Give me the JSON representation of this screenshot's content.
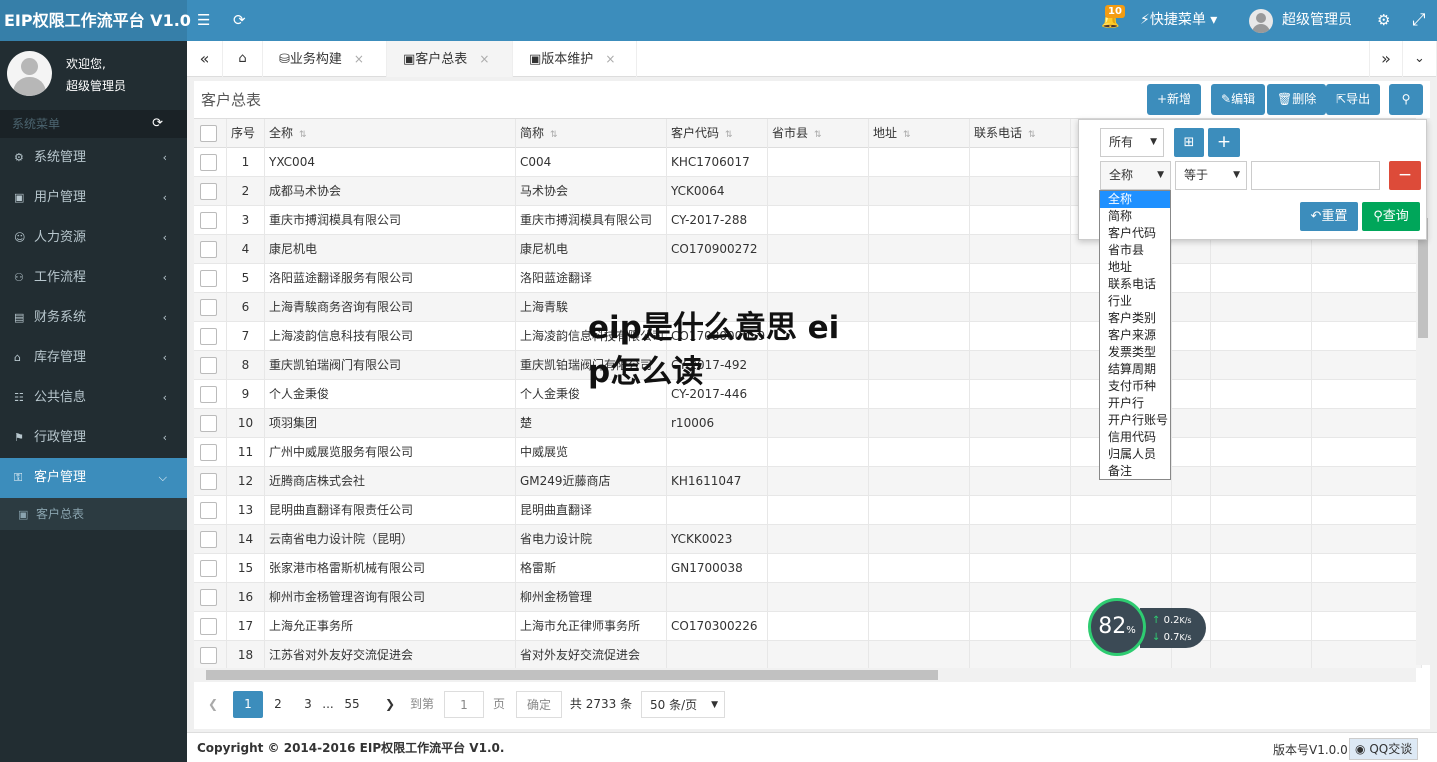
{
  "app": {
    "title": "EIP权限工作流平台 V1.0",
    "notif_count": "10",
    "quick_menu": "快捷菜单",
    "user_name": "超级管理员"
  },
  "sidebar": {
    "welcome": "欢迎您,",
    "user": "超级管理员",
    "menu_header": "系统菜单",
    "items": [
      {
        "label": "系统管理",
        "icon": "gear-icon"
      },
      {
        "label": "用户管理",
        "icon": "id-card-icon"
      },
      {
        "label": "人力资源",
        "icon": "user-icon"
      },
      {
        "label": "工作流程",
        "icon": "users-icon"
      },
      {
        "label": "财务系统",
        "icon": "money-icon"
      },
      {
        "label": "库存管理",
        "icon": "bank-icon"
      },
      {
        "label": "公共信息",
        "icon": "comments-icon"
      },
      {
        "label": "行政管理",
        "icon": "bookmark-icon"
      },
      {
        "label": "客户管理",
        "icon": "lock-icon"
      }
    ],
    "sub_item": "客户总表"
  },
  "tabs": [
    {
      "label": "业务构建"
    },
    {
      "label": "客户总表"
    },
    {
      "label": "版本维护"
    }
  ],
  "panel": {
    "title": "客户总表",
    "buttons": {
      "add": "+新增",
      "edit": "编辑",
      "delete": "删除",
      "export": "导出"
    }
  },
  "table": {
    "columns": [
      "序号",
      "全称",
      "简称",
      "客户代码",
      "省市县",
      "地址",
      "联系电话"
    ],
    "rows": [
      [
        "1",
        "YXC004",
        "C004",
        "KHC1706017"
      ],
      [
        "2",
        "成都马术协会",
        "马术协会",
        "YCK0064"
      ],
      [
        "3",
        "重庆市搏润模具有限公司",
        "重庆市搏润模具有限公司",
        "CY-2017-288"
      ],
      [
        "4",
        "康尼机电",
        "康尼机电",
        "CO170900272"
      ],
      [
        "5",
        "洛阳蓝途翻译服务有限公司",
        "洛阳蓝途翻译",
        ""
      ],
      [
        "6",
        "上海青騃商务咨询有限公司",
        "上海青騃",
        ""
      ],
      [
        "7",
        "上海凌韵信息科技有限公司",
        "上海凌韵信息科技有限公司",
        "CO1708000059"
      ],
      [
        "8",
        "重庆凯铂瑞阀门有限公司",
        "重庆凯铂瑞阀门有限公司",
        "CY-2017-492"
      ],
      [
        "9",
        "个人金秉俊",
        "个人金秉俊",
        "CY-2017-446"
      ],
      [
        "10",
        "项羽集团",
        "楚",
        "r10006"
      ],
      [
        "11",
        "广州中威展览服务有限公司",
        "中威展览",
        ""
      ],
      [
        "12",
        "近腾商店株式会社",
        "GM249近藤商店",
        "KH1611047"
      ],
      [
        "13",
        "昆明曲直翻译有限责任公司",
        "昆明曲直翻译",
        ""
      ],
      [
        "14",
        "云南省电力设计院（昆明）",
        "省电力设计院",
        "YCKK0023"
      ],
      [
        "15",
        "张家港市格雷斯机械有限公司",
        "格雷斯",
        "GN1700038"
      ],
      [
        "16",
        "柳州市金杨管理咨询有限公司",
        "柳州金杨管理",
        ""
      ],
      [
        "17",
        "上海允正事务所",
        "上海市允正律师事务所",
        "CO170300226"
      ],
      [
        "18",
        "江苏省对外友好交流促进会",
        "省对外友好交流促进会",
        ""
      ]
    ]
  },
  "filter": {
    "scope": "所有",
    "field": "全称",
    "operator": "等于",
    "value": "",
    "reset": "重置",
    "query": "查询",
    "options": [
      "全称",
      "简称",
      "客户代码",
      "省市县",
      "地址",
      "联系电话",
      "行业",
      "客户类别",
      "客户来源",
      "发票类型",
      "结算周期",
      "支付币种",
      "开户行",
      "开户行账号",
      "信用代码",
      "归属人员",
      "备注"
    ]
  },
  "pager": {
    "pages": [
      "1",
      "2",
      "3",
      "...",
      "55"
    ],
    "goto": "到第",
    "goto_value": "1",
    "page_unit": "页",
    "confirm": "确定",
    "total": "共 2733 条",
    "page_size": "50 条/页"
  },
  "footer": {
    "copyright": "Copyright © 2014-2016 EIP权限工作流平台 V1.0.",
    "version": "版本号V1.0.0",
    "qq": "QQ交谈"
  },
  "overlay_text": "eip是什么意思 eip怎么读",
  "speed": {
    "percent": "82",
    "unit": "%",
    "up": "0.2",
    "down": "0.7",
    "rate_unit": "K/s"
  }
}
